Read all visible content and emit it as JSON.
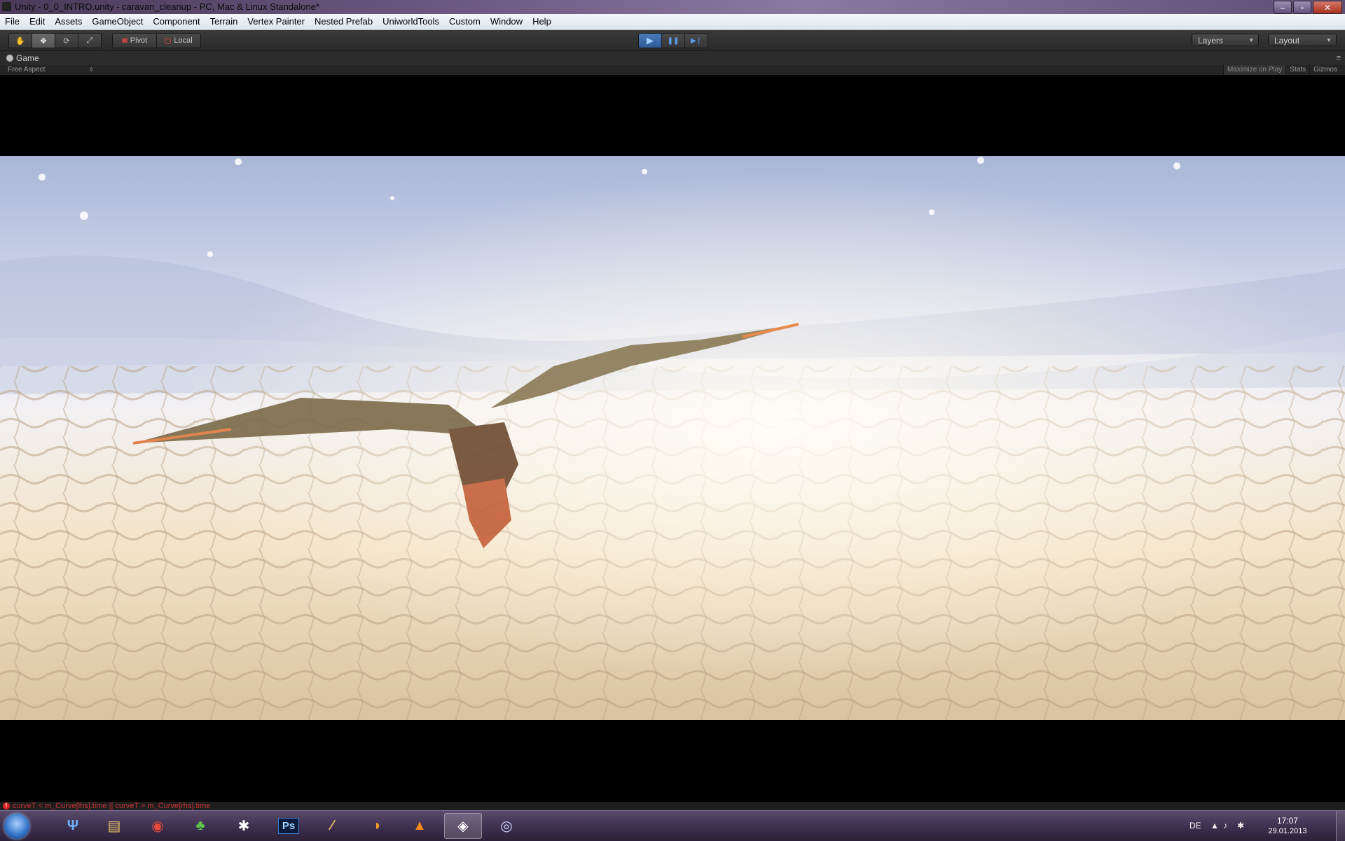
{
  "window": {
    "title": "Unity - 0_0_INTRO.unity - caravan_cleanup - PC, Mac & Linux Standalone*",
    "minimize": "–",
    "maximize": "▫",
    "close": "✕"
  },
  "menubar": {
    "items": [
      "File",
      "Edit",
      "Assets",
      "GameObject",
      "Component",
      "Terrain",
      "Vertex Painter",
      "Nested Prefab",
      "UniworldTools",
      "Custom",
      "Window",
      "Help"
    ]
  },
  "toolbar": {
    "tools": [
      {
        "icon": "hand-icon",
        "glyph": "✋"
      },
      {
        "icon": "move-icon",
        "glyph": "✥"
      },
      {
        "icon": "rotate-icon",
        "glyph": "⟳"
      },
      {
        "icon": "scale-icon",
        "glyph": "⤢"
      }
    ],
    "pivot_label": "Pivot",
    "local_label": "Local",
    "play_glyph": "▶",
    "pause_glyph": "❚❚",
    "step_glyph": "▶❘",
    "layers_label": "Layers",
    "layout_label": "Layout"
  },
  "game_panel": {
    "tab_label": "Game",
    "aspect_label": "Free Aspect",
    "maximize_on_play": "Maximize on Play",
    "stats": "Stats",
    "gizmos": "Gizmos"
  },
  "status": {
    "error_message": "curveT < m_Curve[lhs].time || curveT > m_Curve[rhs].time"
  },
  "taskbar": {
    "apps": [
      {
        "name": "uniworld-app-icon",
        "glyph": "Ψ",
        "color": "#6fb0ff"
      },
      {
        "name": "explorer-icon",
        "glyph": "▤",
        "color": "#e8c66a"
      },
      {
        "name": "chrome-icon",
        "glyph": "◉",
        "color": "#e84a3a"
      },
      {
        "name": "slime-app-icon",
        "glyph": "♣",
        "color": "#5fc84a"
      },
      {
        "name": "zbrush-icon",
        "glyph": "✱",
        "color": "#ffffff"
      },
      {
        "name": "photoshop-icon",
        "glyph": "Ps",
        "color": "#9fd2ff"
      },
      {
        "name": "pen-app-icon",
        "glyph": "∕",
        "color": "#f0c060"
      },
      {
        "name": "blender-icon",
        "glyph": "◑",
        "color": "#f39a2c"
      },
      {
        "name": "vlc-icon",
        "glyph": "▲",
        "color": "#f28a1a"
      },
      {
        "name": "unity-icon",
        "glyph": "◈",
        "color": "#ffffff"
      },
      {
        "name": "remote-app-icon",
        "glyph": "◎",
        "color": "#cfd8ff"
      }
    ],
    "language": "DE",
    "time": "17:07",
    "date": "29.01.2013"
  }
}
